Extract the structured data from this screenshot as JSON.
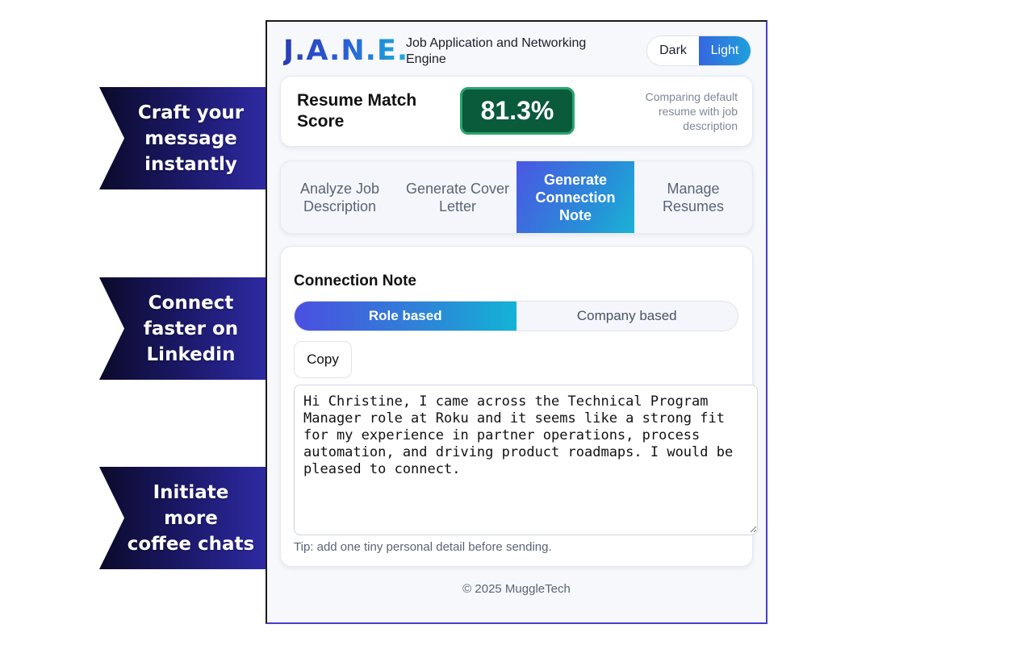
{
  "banners": [
    {
      "text": "Craft your\nmessage\ninstantly"
    },
    {
      "text": "Connect\nfaster on\nLinkedin"
    },
    {
      "text": "Initiate\nmore\ncoffee chats"
    }
  ],
  "app": {
    "logo": "J.A.N.E.",
    "subtitle": "Job Application and Networking Engine",
    "theme": {
      "dark_label": "Dark",
      "light_label": "Light",
      "selected": "Light"
    }
  },
  "score": {
    "label": "Resume Match Score",
    "value": "81.3%",
    "note": "Comparing default resume with job description",
    "badge_color": "#0a5a3c"
  },
  "tabs": [
    {
      "label": "Analyze Job Description",
      "active": false
    },
    {
      "label": "Generate Cover Letter",
      "active": false
    },
    {
      "label": "Generate Connection Note",
      "active": true
    },
    {
      "label": "Manage Resumes",
      "active": false
    }
  ],
  "connection_note": {
    "title": "Connection Note",
    "modes": [
      {
        "label": "Role based",
        "active": true
      },
      {
        "label": "Company based",
        "active": false
      }
    ],
    "copy_label": "Copy",
    "message": "Hi Christine, I came across the Technical Program Manager role at Roku and it seems like a strong fit for my experience in partner operations, process automation, and driving product roadmaps. I would be pleased to connect.",
    "tip": "Tip: add one tiny personal detail before sending."
  },
  "footer": "© 2025 MuggleTech",
  "colors": {
    "accent_start": "#4b4fe0",
    "accent_end": "#12b3d6",
    "banner": "#1d1a6e"
  }
}
